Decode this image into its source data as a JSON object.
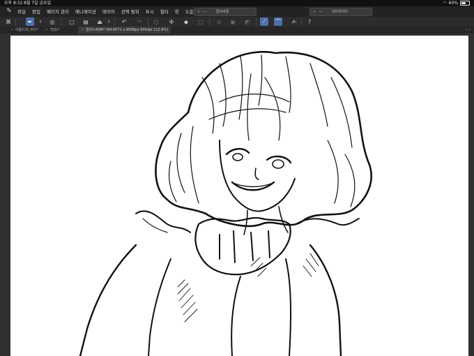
{
  "status_bar": {
    "time": "오후 8:32",
    "date": "8월 7일 금요일",
    "battery": "60%"
  },
  "menu": {
    "items": [
      "파일",
      "편집",
      "페이지 관리",
      "애니메이션",
      "레이어",
      "선택 범위",
      "표시",
      "필터",
      "창",
      "도움말"
    ]
  },
  "palettes": [
    {
      "close": "×",
      "dash": "—",
      "title": "컬러써클"
    },
    {
      "close": "×",
      "dash": "—",
      "title": "내비게이터"
    }
  ],
  "toolbar": {
    "icons": [
      "logo-icon",
      "pen-tool-icon",
      "layer-icon",
      "new-icon",
      "open-icon",
      "save-icon",
      "undo-icon",
      "redo-icon",
      "lasso-icon",
      "transform-icon",
      "fill-icon",
      "selection-icon",
      "slash-icon",
      "tone-icon",
      "gradient-icon",
      "pen-pressure-icon",
      "curve-icon",
      "correction-icon",
      "help-icon"
    ]
  },
  "documents": {
    "tabs": [
      {
        "label": "이름018_001*",
        "active": false
      },
      {
        "label": "TJQL*",
        "active": false
      },
      {
        "label": "일러스트89* (64.6071 x 8598px 600dpi 112.8%)",
        "active": true
      }
    ],
    "arrows": "‹ ›"
  },
  "canvas": {
    "background": "#ffffff",
    "subject": "ink line drawing of a smiling girl with wavy bob hair"
  },
  "colors": {
    "accent": "#4c6fa8",
    "menu_bg": "#232325",
    "toolbar_bg": "#2c2c2e"
  }
}
